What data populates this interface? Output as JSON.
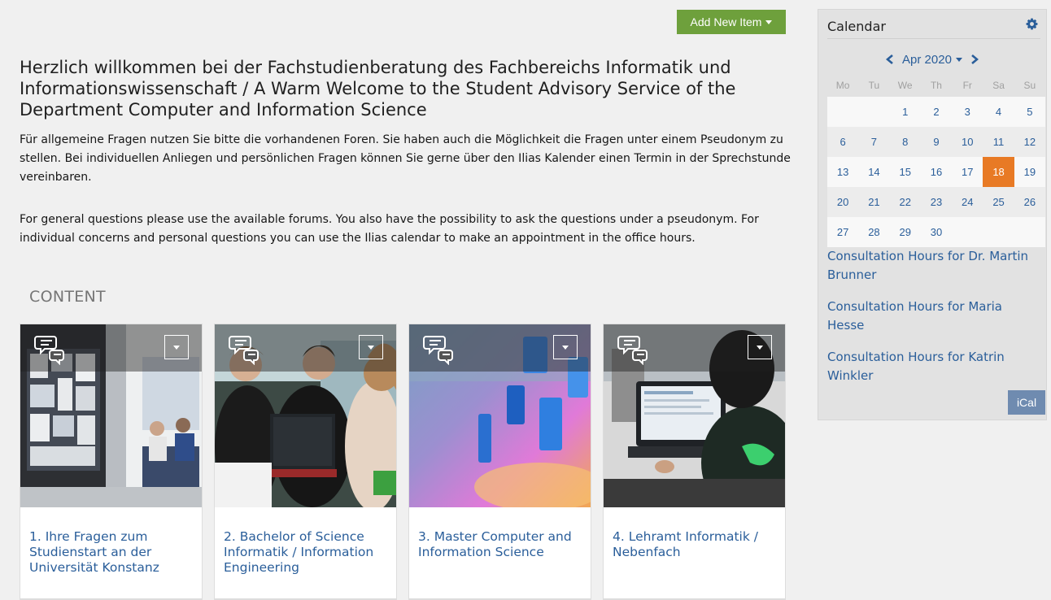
{
  "toolbar": {
    "add_new_item_label": "Add New Item"
  },
  "welcome": {
    "title": "Herzlich willkommen bei der Fachstudienberatung des Fachbereichs Informatik und Informationswissenschaft / A Warm Welcome to the Student Advisory Service of the Department Computer and Information Science",
    "paragraph_de": "Für allgemeine Fragen nutzen Sie bitte die vorhandenen Foren. Sie haben auch die Möglichkeit die Fragen unter einem Pseudonym zu stellen. Bei individuellen Anliegen und persönlichen Fragen können Sie gerne über den Ilias Kalender einen Termin in der Sprechstunde vereinbaren.",
    "paragraph_en": "For general questions please use the available forums. You also have the possibility to ask the questions under a pseudonym. For individual concerns and personal questions you can use the Ilias calendar to make an appointment in the office hours."
  },
  "content": {
    "heading": "CONTENT",
    "cards": [
      {
        "title": "1. Ihre Fragen zum Studienstart an der Universität Konstanz",
        "icon": "forum-icon"
      },
      {
        "title": "2. Bachelor of Science Informatik / Information Engineering",
        "icon": "forum-icon"
      },
      {
        "title": "3. Master Computer and Information Science",
        "icon": "forum-icon"
      },
      {
        "title": "4. Lehramt Informatik / Nebenfach",
        "icon": "forum-icon"
      }
    ]
  },
  "calendar": {
    "title": "Calendar",
    "month_label": "Apr 2020",
    "weekdays": [
      "Mo",
      "Tu",
      "We",
      "Th",
      "Fr",
      "Sa",
      "Su"
    ],
    "weeks": [
      [
        "",
        "",
        "1",
        "2",
        "3",
        "4",
        "5"
      ],
      [
        "6",
        "7",
        "8",
        "9",
        "10",
        "11",
        "12"
      ],
      [
        "13",
        "14",
        "15",
        "16",
        "17",
        "18",
        "19"
      ],
      [
        "20",
        "21",
        "22",
        "23",
        "24",
        "25",
        "26"
      ],
      [
        "27",
        "28",
        "29",
        "30",
        "",
        "",
        ""
      ]
    ],
    "today": "18",
    "consultation_links": [
      "Consultation Hours for Dr. Martin Brunner",
      "Consultation Hours for Maria Hesse",
      "Consultation Hours for Katrin Winkler"
    ],
    "ical_label": "iCal"
  },
  "colors": {
    "accent_green": "#6ea03c",
    "link_blue": "#2a5e9a",
    "today_orange": "#e87a25",
    "ical_blue": "#6f8bb0"
  }
}
